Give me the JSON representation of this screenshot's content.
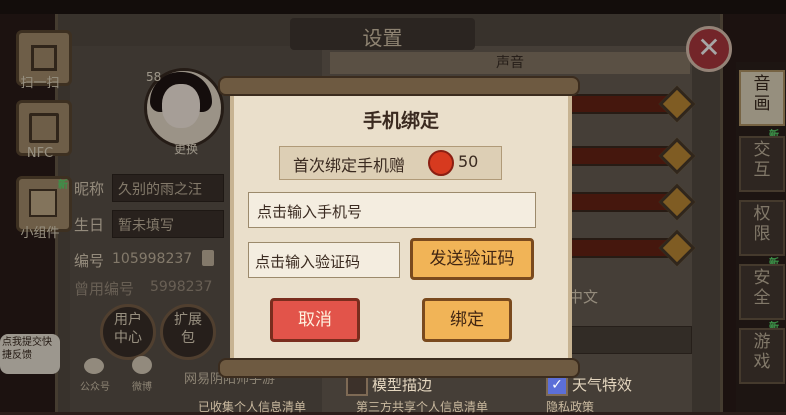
{
  "topbar": {
    "left_text": "",
    "mid_text": ""
  },
  "settings": {
    "title": "设置",
    "sound_header": "声音"
  },
  "side_menu": [
    {
      "label": "扫一扫",
      "icon": "scan-icon"
    },
    {
      "label": "NFC",
      "icon": "nfc-icon"
    },
    {
      "label": "小组件",
      "icon": "widget-icon",
      "badge": "新"
    }
  ],
  "tabs": [
    {
      "label": "音画",
      "active": true,
      "badge": ""
    },
    {
      "label": "交互",
      "active": false,
      "badge": "新"
    },
    {
      "label": "权限",
      "active": false,
      "badge": ""
    },
    {
      "label": "安全",
      "active": false,
      "badge": "新"
    },
    {
      "label": "游戏",
      "active": false,
      "badge": "新"
    }
  ],
  "profile": {
    "level": "58",
    "change_label": "更换",
    "nickname_label": "昵称",
    "nickname_value": "久别的雨之汪",
    "birthday_label": "生日",
    "birthday_value": "暂未填写",
    "id_label": "编号",
    "id_value": "105998237",
    "old_id_label": "曾用编号",
    "old_id_value": "5998237",
    "user_center": "用户中心",
    "expand_pack": "扩展包",
    "feedback": "点我提交快捷反馈",
    "wechat_label": "公众号",
    "weibo_label": "微博",
    "net_text": "网易阴阳师手游"
  },
  "dialog": {
    "title": "手机绑定",
    "reward_text": "首次绑定手机赠",
    "reward_amount": "50",
    "phone_placeholder": "点击输入手机号",
    "code_placeholder": "点击输入验证码",
    "send_code": "发送验证码",
    "cancel": "取消",
    "bind": "绑定"
  },
  "options": {
    "language_value": "中文",
    "model_outline": "模型描边",
    "model_outline_checked": false,
    "weather_effect": "天气特效",
    "weather_effect_checked": true
  },
  "footer": {
    "collected_list": "已收集个人信息清单",
    "shared_list": "第三方共享个人信息清单",
    "privacy": "隐私政策"
  },
  "colors": {
    "accent_orange": "#f1b457",
    "cancel_red": "#e2544a",
    "paper": "#eadfcb"
  }
}
